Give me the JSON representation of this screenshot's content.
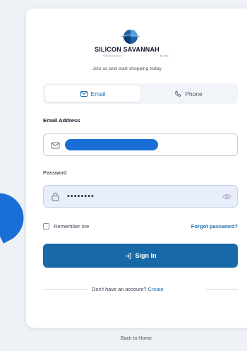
{
  "brand": {
    "name": "SILICON SAVANNAH",
    "subtitle": "Technology Solutions",
    "tag": "Go 4 less"
  },
  "tagline": "Join us and start shopping today",
  "tabs": [
    {
      "label": "Email",
      "icon": "mail-icon",
      "active": true
    },
    {
      "label": "Phone",
      "icon": "phone-icon",
      "active": false
    }
  ],
  "form": {
    "email_label": "Email Address",
    "email_value": "",
    "password_label": "Password",
    "password_value": "••••••••",
    "remember_label": "Remember me",
    "forgot_label": "Forgot password?",
    "signin_label": "Sign In"
  },
  "footer": {
    "no_account_text": "Don't have an account?",
    "create_label": "Create",
    "back_home": "Back to Home"
  },
  "colors": {
    "accent": "#1869a7",
    "link": "#1d6fb1",
    "redaction": "#1a6fd6"
  }
}
